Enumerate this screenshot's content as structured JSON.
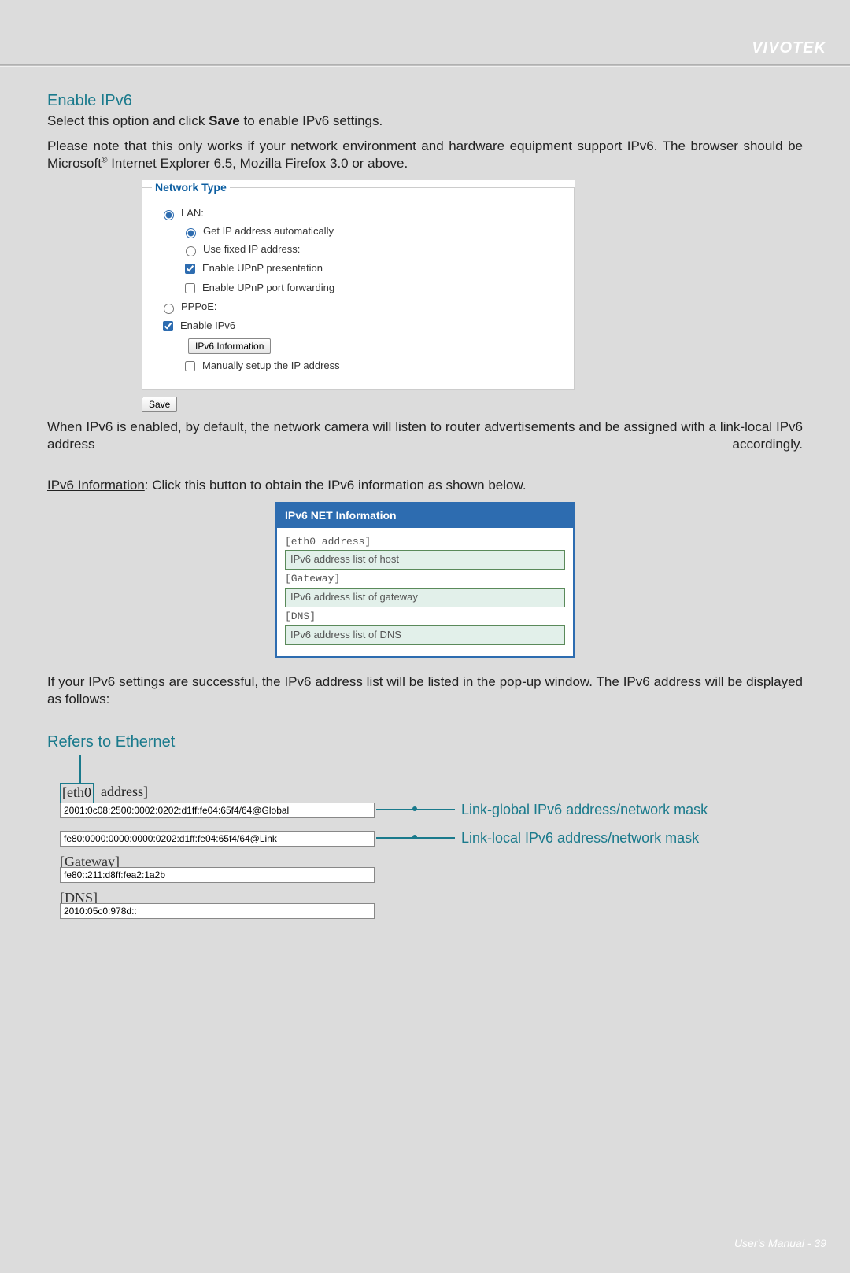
{
  "brand": "VIVOTEK",
  "header1": "Enable IPv6",
  "para1_before": "Select this option and click ",
  "para1_bold": "Save",
  "para1_after": " to enable IPv6 settings.",
  "para2_a": "Please note that this only works if your network environment and hardware equipment support IPv6. The browser should be Microsoft",
  "para2_sup": "®",
  "para2_b": " Internet Explorer 6.5, Mozilla Firefox 3.0 or above.",
  "network_type": {
    "legend": "Network Type",
    "lan": "LAN:",
    "get_ip": "Get IP address automatically",
    "fixed_ip": "Use fixed IP address:",
    "upnp_pres": "Enable UPnP presentation",
    "upnp_fwd": "Enable UPnP port forwarding",
    "pppoe": "PPPoE:",
    "enable_ipv6": "Enable IPv6",
    "ipv6_info_btn": "IPv6 Information",
    "manual_ip": "Manually setup the IP address",
    "save": "Save"
  },
  "para3": "When IPv6 is enabled, by default, the network camera will listen to router advertisements and be assigned with a link-local IPv6 address accordingly.",
  "ipv6_info_label": "IPv6 Information",
  "ipv6_info_rest": ": Click this button to obtain the IPv6 information as shown below.",
  "popup": {
    "title": "IPv6 NET Information",
    "eth0_label": "[eth0 address]",
    "eth0_field": "IPv6 address list of host",
    "gw_label": "[Gateway]",
    "gw_field": "IPv6 address list of gateway",
    "dns_label": "[DNS]",
    "dns_field": "IPv6 address list of DNS"
  },
  "para4": "If your IPv6 settings are successful, the IPv6 address list will be listed in the pop-up window. The IPv6 address will be displayed as follows:",
  "refers_header": "Refers to Ethernet",
  "diagram": {
    "eth0_boxed": "[eth0",
    "eth0_rest": " address]",
    "global_addr": "2001:0c08:2500:0002:0202:d1ff:fe04:65f4/64@Global",
    "link_addr": "fe80:0000:0000:0000:0202:d1ff:fe04:65f4/64@Link",
    "gateway_label": "[Gateway]",
    "gateway_addr": "fe80::211:d8ff:fea2:1a2b",
    "dns_label": "[DNS]",
    "dns_addr": "2010:05c0:978d::",
    "callout_global": "Link-global IPv6 address/network mask",
    "callout_link": "Link-local IPv6 address/network mask"
  },
  "footer_a": "User's Manual - ",
  "footer_b": "39"
}
